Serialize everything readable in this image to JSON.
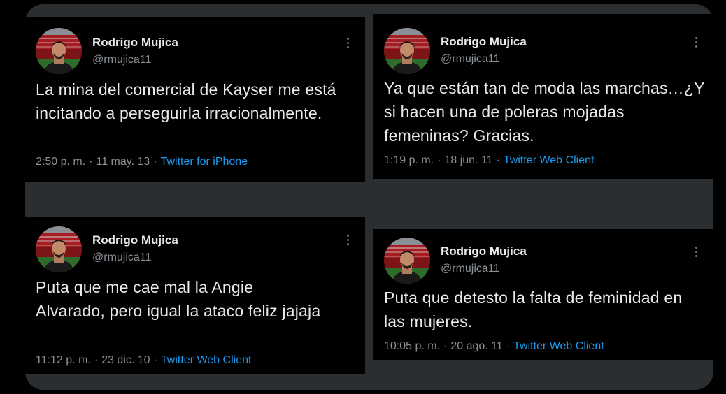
{
  "colors": {
    "background": "#000000",
    "frame": "#2b2e31",
    "text": "#e7e9ea",
    "muted": "#8b9196",
    "link": "#1d9bf0"
  },
  "tweets": [
    {
      "name": "Rodrigo Mujica",
      "handle": "@rmujica11",
      "text": "La mina del comercial de Kayser me está incitando a perseguirla irracionalmente.",
      "time": "2:50 p. m.",
      "date": "11 may. 13",
      "separator": "·",
      "source": "Twitter for iPhone",
      "menu_icon": "more-vertical-icon",
      "avatar_icon": "profile-avatar-stadium"
    },
    {
      "name": "Rodrigo Mujica",
      "handle": "@rmujica11",
      "text": "Ya que están tan de moda las marchas…¿Y si hacen una de poleras mojadas femeninas? Gracias.",
      "time": "1:19 p. m.",
      "date": "18 jun. 11",
      "separator": "·",
      "source": "Twitter Web Client",
      "menu_icon": "more-vertical-icon",
      "avatar_icon": "profile-avatar-stadium"
    },
    {
      "name": "Rodrigo Mujica",
      "handle": "@rmujica11",
      "text": "Puta que me cae mal la Angie Alvarado, pero igual la ataco feliz jajaja",
      "time": "11:12 p. m.",
      "date": "23 dic. 10",
      "separator": "·",
      "source": "Twitter Web Client",
      "menu_icon": "more-vertical-icon",
      "avatar_icon": "profile-avatar-stadium"
    },
    {
      "name": "Rodrigo Mujica",
      "handle": "@rmujica11",
      "text": "Puta que detesto la falta de feminidad en las mujeres.",
      "time": "10:05 p. m.",
      "date": "20 ago. 11",
      "separator": "·",
      "source": "Twitter Web Client",
      "menu_icon": "more-vertical-icon",
      "avatar_icon": "profile-avatar-stadium"
    }
  ]
}
